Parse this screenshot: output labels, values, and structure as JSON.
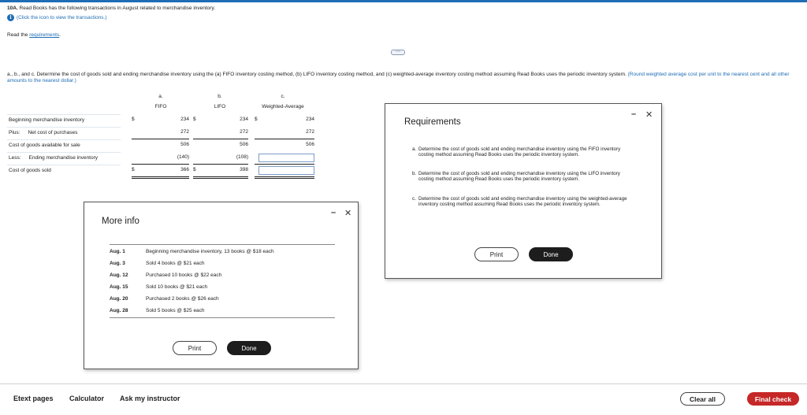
{
  "question": {
    "number": "10A.",
    "text": "Read Books has the following transactions in August related to merchandise inventory.",
    "info_link": "(Click the icon to view the transactions.)",
    "read_prefix": "Read the",
    "requirements_link": "requirements",
    "dots": "⋯",
    "instruction": "a., b., and c. Determine the cost of goods sold and ending merchandise inventory using the (a) FIFO inventory costing method, (b) LIFO inventory costing method, and (c) weighted-average inventory costing method assuming Read Books uses the periodic inventory system.",
    "instruction_note": "(Round weighted average cost per unit to the nearest cent and all other amounts to the nearest dollar.)"
  },
  "table": {
    "headers": [
      {
        "letter": "a.",
        "name": "FIFO"
      },
      {
        "letter": "b.",
        "name": "LIFO"
      },
      {
        "letter": "c.",
        "name": "Weighted-Average"
      }
    ],
    "dollar": "$",
    "rows": [
      {
        "label": "Beginning merchandise inventory",
        "prefix": "",
        "fifo": "234",
        "lifo": "234",
        "wa": "234"
      },
      {
        "label": "Net cost of purchases",
        "prefix": "Plus:",
        "fifo": "272",
        "lifo": "272",
        "wa": "272"
      },
      {
        "label": "Cost of goods available for sale",
        "prefix": "",
        "fifo": "506",
        "lifo": "506",
        "wa": "506"
      },
      {
        "label": "Ending merchandise inventory",
        "prefix": "Less:",
        "fifo": "(140)",
        "lifo": "(108)",
        "wa": ""
      },
      {
        "label": "Cost of goods sold",
        "prefix": "",
        "fifo": "366",
        "lifo": "398",
        "wa": ""
      }
    ]
  },
  "more_info": {
    "title": "More info",
    "minimize": "–",
    "close": "✕",
    "rows": [
      {
        "date": "Aug. 1",
        "text": "Beginning merchandise inventory, 13 books @ $18 each"
      },
      {
        "date": "Aug. 3",
        "text": "Sold 4 books @ $21 each"
      },
      {
        "date": "Aug. 12",
        "text": "Purchased 10 books @ $22 each"
      },
      {
        "date": "Aug. 15",
        "text": "Sold 10 books @ $21 each"
      },
      {
        "date": "Aug. 20",
        "text": "Purchased 2 books @ $26 each"
      },
      {
        "date": "Aug. 28",
        "text": "Sold 5 books @ $25 each"
      }
    ],
    "print_label": "Print",
    "done_label": "Done"
  },
  "requirements": {
    "title": "Requirements",
    "minimize": "–",
    "close": "✕",
    "items": [
      {
        "letter": "a.",
        "text": "Determine the cost of goods sold and ending merchandise inventory using the FIFO inventory costing method assuming Read Books uses the periodic inventory system."
      },
      {
        "letter": "b.",
        "text": "Determine the cost of goods sold and ending merchandise inventory using the LIFO inventory costing method assuming Read Books uses the periodic inventory system."
      },
      {
        "letter": "c.",
        "text": "Determine the cost of goods sold and ending merchandise inventory using the weighted-average inventory costing method assuming Read Books uses the periodic inventory system."
      }
    ],
    "print_label": "Print",
    "done_label": "Done"
  },
  "bottom_bar": {
    "etext": "Etext pages",
    "calculator": "Calculator",
    "ask": "Ask my instructor",
    "clear_all": "Clear all",
    "final_check": "Final check"
  },
  "colors": {
    "accent": "#1f6db5",
    "final_check": "#c62828",
    "done_button": "#1d1d1d"
  }
}
